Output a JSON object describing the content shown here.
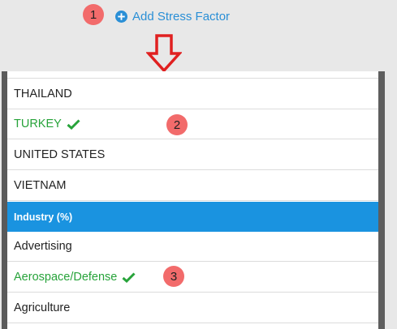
{
  "header": {
    "add_label": "Add Stress Factor",
    "step1": "1",
    "icons": {
      "add": "plus-circle-icon",
      "arrow": "arrow-down-icon"
    },
    "arrow_color": "#e02020",
    "accent": "#2a8fd6"
  },
  "list": {
    "rows": [
      {
        "label": "THAILAND",
        "selected": false
      },
      {
        "label": "TURKEY",
        "selected": true
      },
      {
        "label": "UNITED STATES",
        "selected": false
      },
      {
        "label": "VIETNAM",
        "selected": false
      },
      {
        "label": "Industry (%)",
        "category": true
      },
      {
        "label": "Advertising",
        "selected": false
      },
      {
        "label": "Aerospace/Defense",
        "selected": true
      },
      {
        "label": "Agriculture",
        "selected": false
      }
    ],
    "selected_color": "#27a33a",
    "category_color": "#1a93e0"
  },
  "annotations": {
    "step2": "2",
    "step3": "3",
    "badge_color": "#f26b6b"
  }
}
